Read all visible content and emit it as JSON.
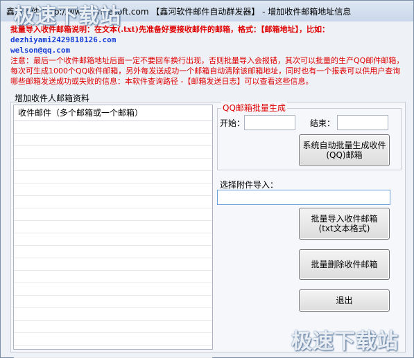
{
  "window": {
    "title": "鑫河软件 http://www.xinhesoft.com 【鑫河软件邮件自动群发器】 - 增加收件邮箱地址信息"
  },
  "watermark": "极速下载站",
  "notice": {
    "line1": "批量导入收件邮箱说明：在文本(.txt)先准备好要接收邮件的邮箱，格式：【邮箱地址】，比如：",
    "email1": "dezhiyami2429810126.com",
    "email2": "welson@qq.com",
    "note": "注意：最后一个收件邮箱地址后面一定不要回车换行出现，否则批量导入会报错，其次可以批量的生产QQ邮件邮箱，每次可生成1000个QQ收件邮箱，另外每发送成功一个邮箱自动清除该邮箱地址，同时也有一个报表可以供用户查询哪些邮箱发送成功或失败的信息：本软件查询路径 -【邮箱发送日志】可以查看这些信息。"
  },
  "group": {
    "label": "增加收件人邮箱资料",
    "list_header": "收件邮件（多个邮箱或一个邮箱）"
  },
  "qq": {
    "legend": "QQ邮箱批量生成",
    "start_label": "开始：",
    "end_label": "结束：",
    "start_value": "",
    "end_value": "",
    "generate_btn_line1": "系统自动批量生成收件",
    "generate_btn_line2": "(QQ)邮箱"
  },
  "attachment": {
    "label": "选择附件导入：",
    "value": ""
  },
  "buttons": {
    "import_line1": "批量导入收件邮箱",
    "import_line2": "(txt文本格式)",
    "delete": "批量删除收件邮箱",
    "exit": "退出"
  }
}
